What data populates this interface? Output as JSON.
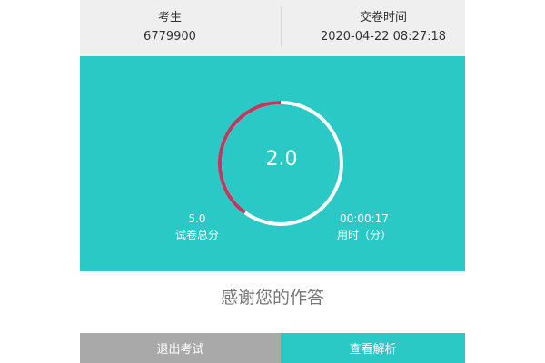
{
  "header": {
    "candidate_label": "考生",
    "candidate_value": "6779900",
    "submit_time_label": "交卷时间",
    "submit_time_value": "2020-04-22 08:27:18"
  },
  "result": {
    "score": "2.0",
    "score_fraction": 0.4,
    "total_score_value": "5.0",
    "total_score_label": "试卷总分",
    "time_used_value": "00:00:17",
    "time_used_label": "用时（分）"
  },
  "message": "感谢您的作答",
  "actions": {
    "exit_label": "退出考试",
    "review_label": "查看解析"
  },
  "colors": {
    "accent": "#2ac9c6",
    "ring_score": "#c0385e",
    "ring_rest": "#ffffff",
    "exit_button": "#a9a9a9"
  }
}
